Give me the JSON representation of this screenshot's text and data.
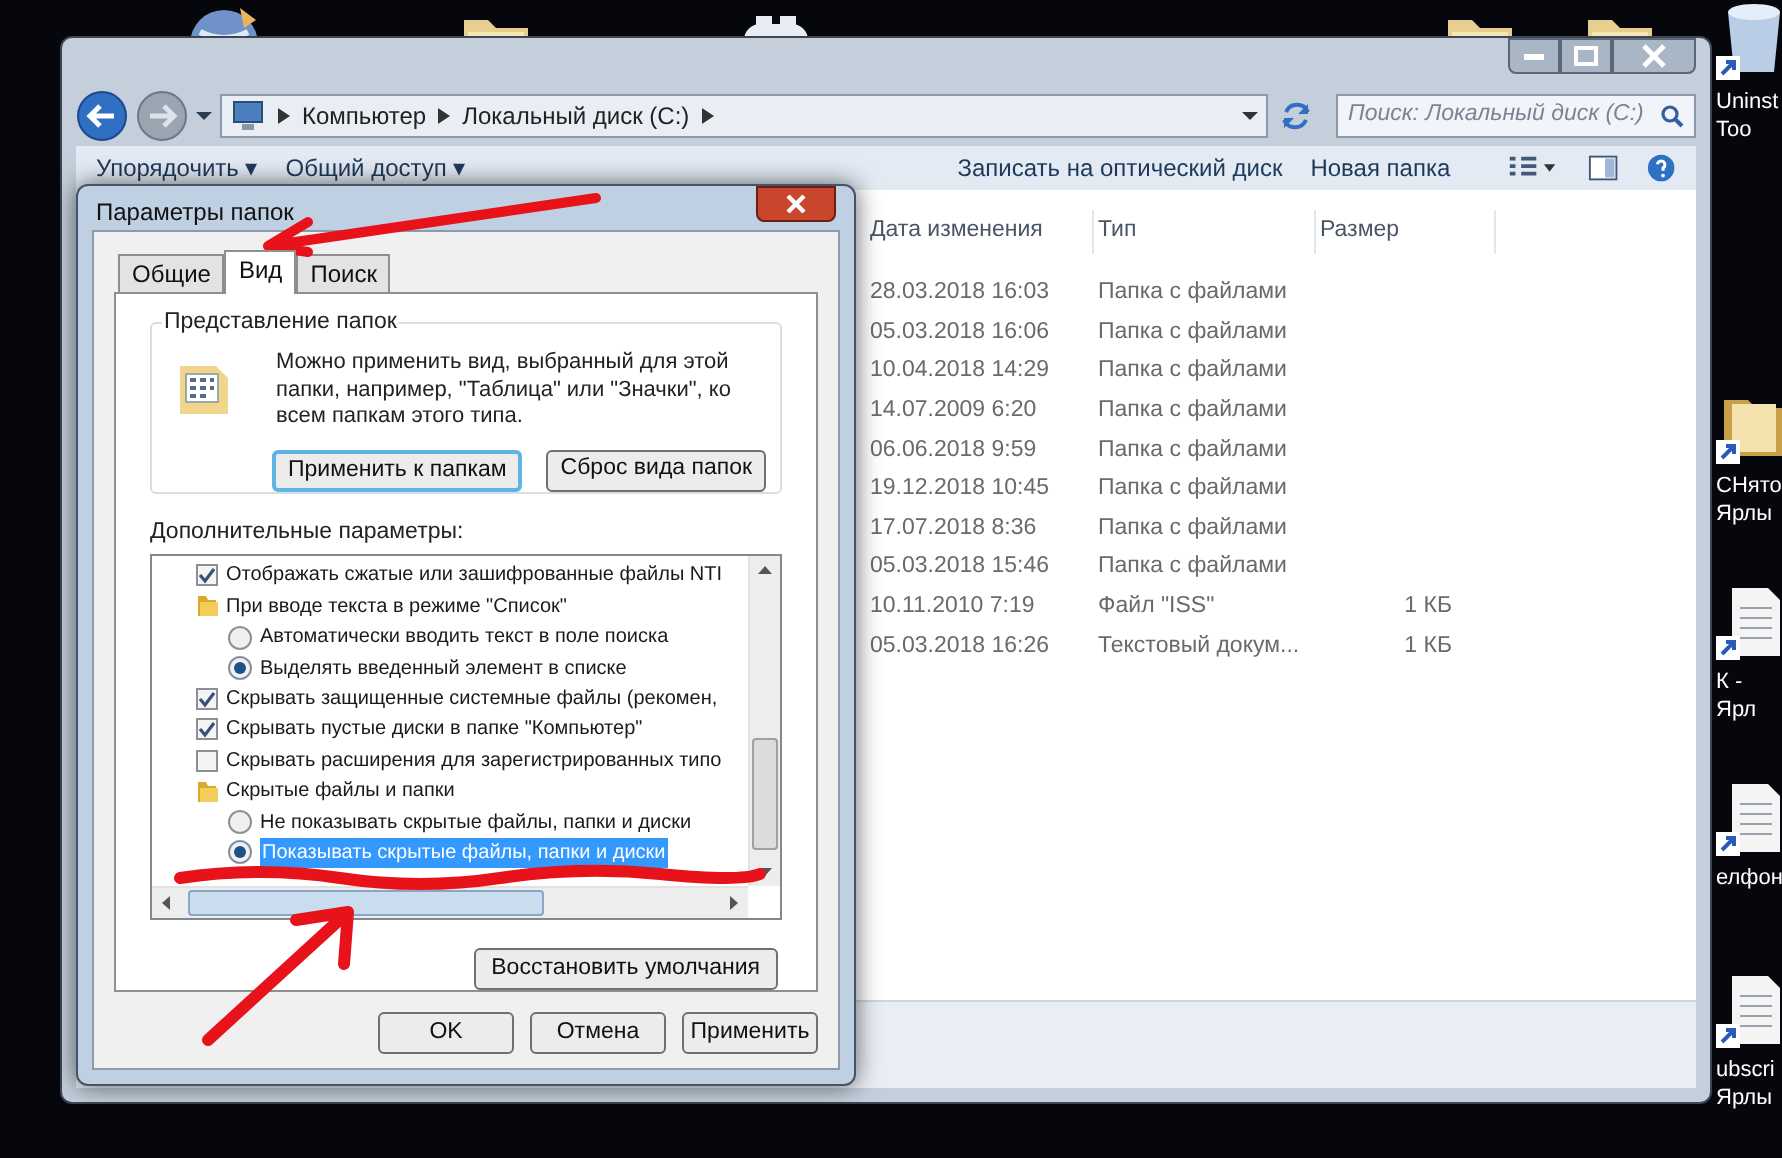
{
  "desktop_icons_top": [
    {
      "kind": "globe"
    },
    {
      "kind": "folder"
    },
    {
      "kind": "gamepad"
    },
    {
      "kind": "folder"
    },
    {
      "kind": "folder"
    }
  ],
  "desktop_icons_right": [
    {
      "kind": "bin",
      "label": "Uninst\nToo"
    },
    {
      "kind": "folder",
      "label": "СНято\nЯрлы"
    },
    {
      "kind": "doc",
      "label": "К - Ярл"
    },
    {
      "kind": "doc",
      "label": "елфон"
    },
    {
      "kind": "doc",
      "label": "ubscri\nЯрлы"
    }
  ],
  "explorer": {
    "breadcrumbs": [
      "Компьютер",
      "Локальный диск (C:)"
    ],
    "search": {
      "placeholder": "Поиск: Локальный диск (C:)"
    },
    "toolbar": [
      "Упорядочить ▾",
      "Общий доступ ▾",
      "Записать на оптический диск",
      "Новая папка"
    ],
    "columns": [
      "Дата изменения",
      "Тип",
      "Размер"
    ],
    "rows": [
      {
        "date": "28.03.2018 16:03",
        "type": "Папка с файлами",
        "size": ""
      },
      {
        "date": "05.03.2018 16:06",
        "type": "Папка с файлами",
        "size": ""
      },
      {
        "date": "10.04.2018 14:29",
        "type": "Папка с файлами",
        "size": ""
      },
      {
        "date": "14.07.2009 6:20",
        "type": "Папка с файлами",
        "size": ""
      },
      {
        "date": "06.06.2018 9:59",
        "type": "Папка с файлами",
        "size": ""
      },
      {
        "date": "19.12.2018 10:45",
        "type": "Папка с файлами",
        "size": ""
      },
      {
        "date": "17.07.2018 8:36",
        "type": "Папка с файлами",
        "size": ""
      },
      {
        "date": "05.03.2018 15:46",
        "type": "Папка с файлами",
        "size": ""
      },
      {
        "date": "10.11.2010 7:19",
        "type": "Файл \"ISS\"",
        "size": "1 КБ"
      },
      {
        "date": "05.03.2018 16:26",
        "type": "Текстовый докум...",
        "size": "1 КБ"
      }
    ]
  },
  "dialog": {
    "title": "Параметры папок",
    "tabs": [
      {
        "label": "Общие",
        "selected": false
      },
      {
        "label": "Вид",
        "selected": true
      },
      {
        "label": "Поиск",
        "selected": false
      }
    ],
    "folder_views": {
      "title": "Представление папок",
      "text": "Можно применить вид, выбранный для этой папки, например, \"Таблица\" или \"Значки\", ко всем папкам этого типа.",
      "buttons": [
        {
          "label": "Применить к папкам",
          "focused": true
        },
        {
          "label": "Сброс вида папок",
          "focused": false
        }
      ]
    },
    "advanced_label": "Дополнительные параметры:",
    "advanced": [
      {
        "kind": "checkbox",
        "label": "Отображать сжатые или зашифрованные файлы NTI",
        "checked": true
      },
      {
        "kind": "folder",
        "label": "При вводе текста в режиме \"Список\"",
        "children": [
          {
            "kind": "radio",
            "label": "Автоматически вводить текст в поле поиска",
            "selected": false,
            "focused": false
          },
          {
            "kind": "radio",
            "label": "Выделять введенный элемент в списке",
            "selected": true,
            "focused": false
          }
        ]
      },
      {
        "kind": "checkbox",
        "label": "Скрывать защищенные системные файлы (рекомен,",
        "checked": true
      },
      {
        "kind": "checkbox",
        "label": "Скрывать пустые диски в папке \"Компьютер\"",
        "checked": true
      },
      {
        "kind": "checkbox",
        "label": "Скрывать расширения для зарегистрированных типо",
        "checked": false
      },
      {
        "kind": "folder",
        "label": "Скрытые файлы и папки",
        "children": [
          {
            "kind": "radio",
            "label": "Не показывать скрытые файлы, папки и диски",
            "selected": false,
            "focused": false
          },
          {
            "kind": "radio",
            "label": "Показывать скрытые файлы, папки и диски",
            "selected": true,
            "focused": true
          }
        ]
      }
    ],
    "restore_button": "Восстановить умолчания",
    "buttons": [
      "OK",
      "Отмена",
      "Применить"
    ]
  }
}
